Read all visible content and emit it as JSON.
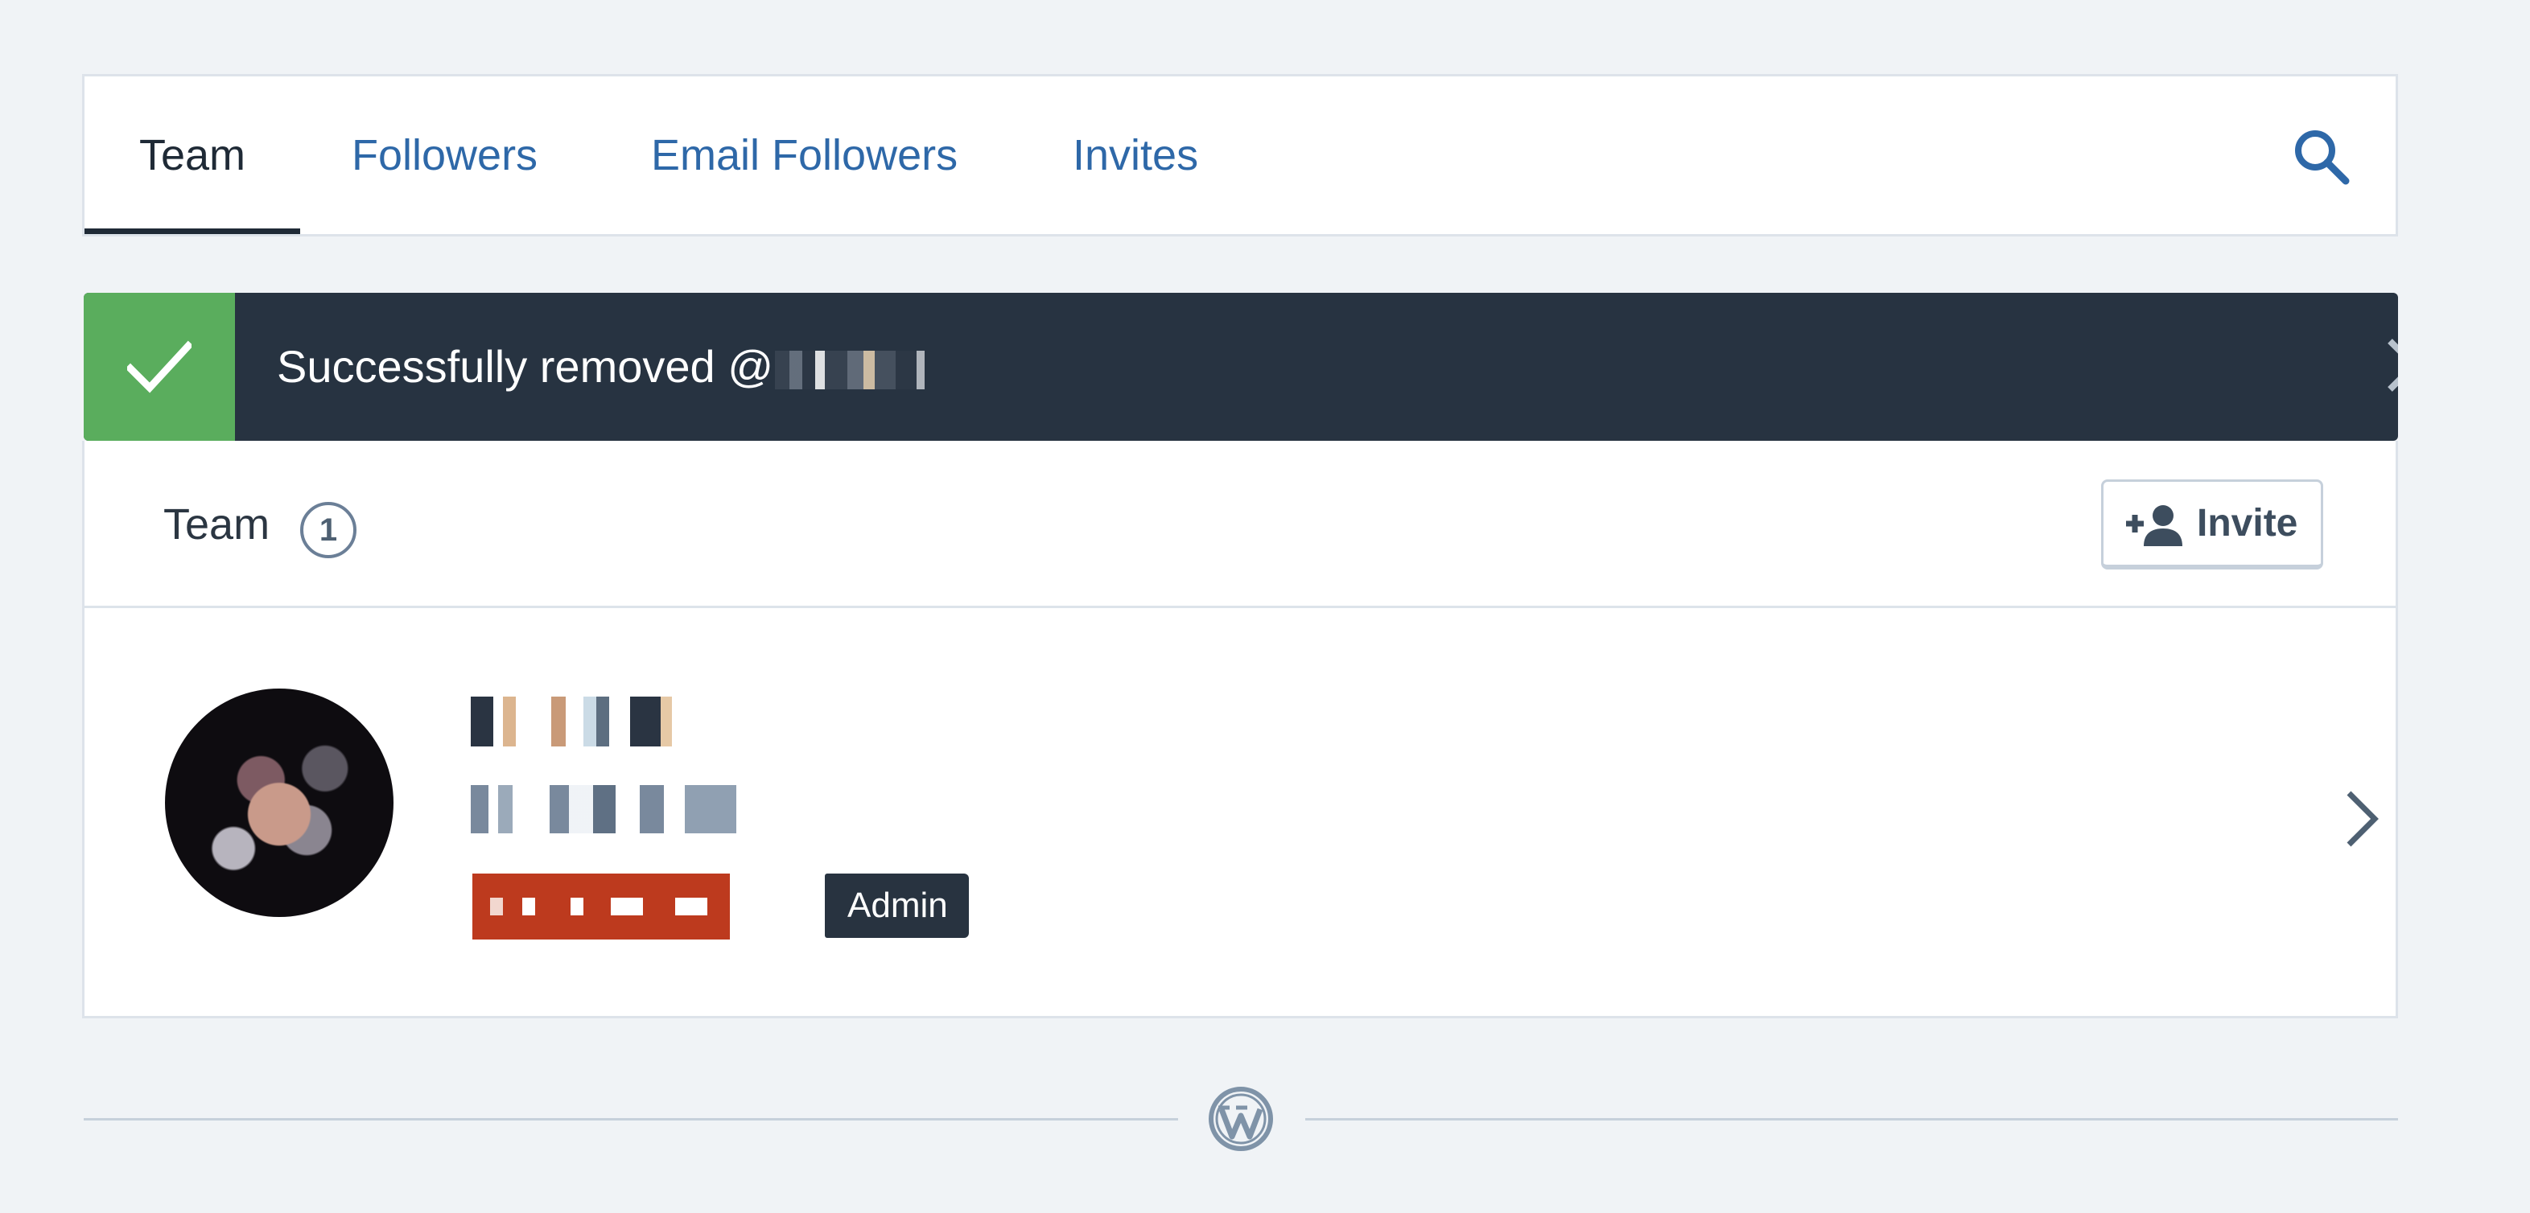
{
  "tabs": [
    {
      "label": "Team",
      "active": true
    },
    {
      "label": "Followers",
      "active": false
    },
    {
      "label": "Email Followers",
      "active": false
    },
    {
      "label": "Invites",
      "active": false
    }
  ],
  "nav_search_icon": "search-icon",
  "notice": {
    "text": "Successfully removed @",
    "status": "success",
    "status_icon": "checkmark-icon",
    "close_icon": "close-icon",
    "colors": {
      "background": "#273341",
      "status": "#5aad5d"
    }
  },
  "team": {
    "title": "Team",
    "count": "1",
    "invite_button": "Invite",
    "invite_icon": "person-add-icon"
  },
  "member": {
    "role_badge": "Admin",
    "chevron_icon": "chevron-right-icon"
  },
  "footer": {
    "logo_icon": "wordpress-logo-icon"
  },
  "colors": {
    "accent": "#2e68a8",
    "text_dark": "#1f2a36",
    "page_background": "#f0f3f6"
  }
}
